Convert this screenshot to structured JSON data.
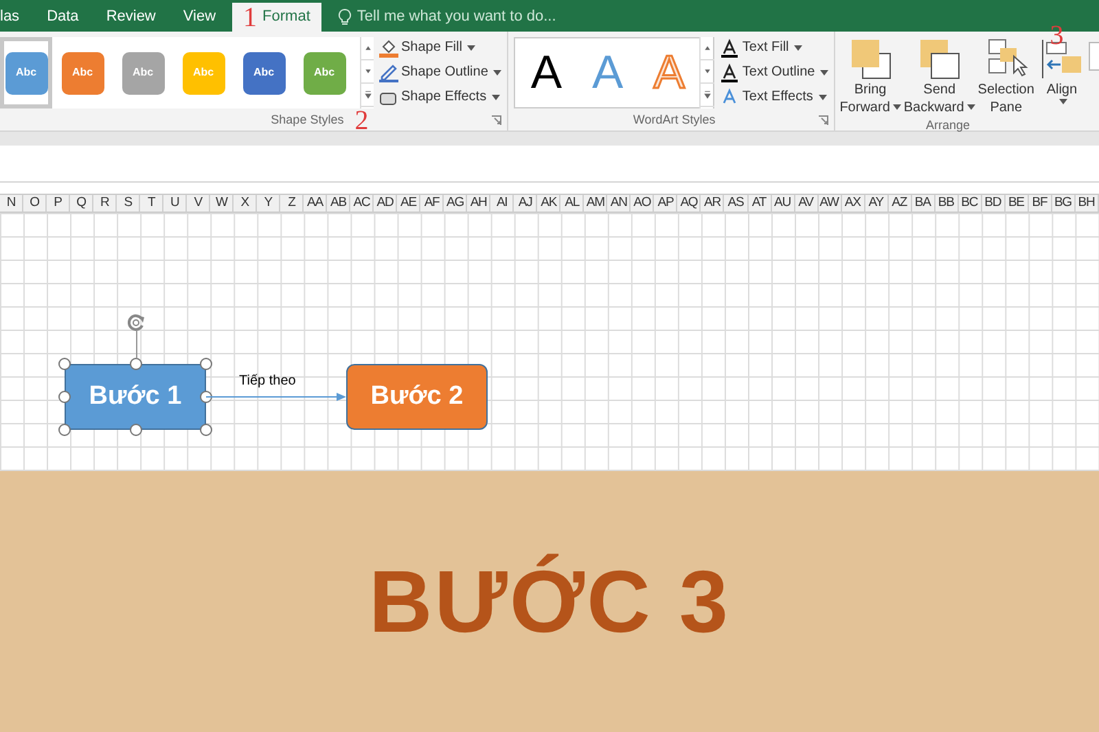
{
  "tabs": [
    {
      "label": "las",
      "selected": false
    },
    {
      "label": "Data",
      "selected": false
    },
    {
      "label": "Review",
      "selected": false
    },
    {
      "label": "View",
      "selected": false
    },
    {
      "label": "Format",
      "selected": true,
      "marker": "1"
    }
  ],
  "tell_me": {
    "placeholder": "Tell me what you want to do..."
  },
  "shape_styles": {
    "label": "Shape Styles",
    "marker": "2",
    "swatches": [
      {
        "label": "Abc",
        "color": "#5b9bd5",
        "selected": true
      },
      {
        "label": "Abc",
        "color": "#ed7d31",
        "selected": false
      },
      {
        "label": "Abc",
        "color": "#a5a5a5",
        "selected": false
      },
      {
        "label": "Abc",
        "color": "#ffc000",
        "selected": false
      },
      {
        "label": "Abc",
        "color": "#4472c4",
        "selected": false
      },
      {
        "label": "Abc",
        "color": "#70ad47",
        "selected": false
      }
    ],
    "commands": [
      {
        "label": "Shape Fill",
        "kind": "fill"
      },
      {
        "label": "Shape Outline",
        "kind": "outline"
      },
      {
        "label": "Shape Effects",
        "kind": "effects"
      }
    ]
  },
  "wordart_styles": {
    "label": "WordArt Styles",
    "samples": [
      {
        "label": "A",
        "kind": "black"
      },
      {
        "label": "A",
        "kind": "blue"
      },
      {
        "label": "A",
        "kind": "orange"
      }
    ],
    "commands": [
      {
        "label": "Text Fill",
        "kind": "fill"
      },
      {
        "label": "Text Outline",
        "kind": "outline"
      },
      {
        "label": "Text Effects",
        "kind": "effects"
      }
    ]
  },
  "arrange": {
    "label": "Arrange",
    "marker": "3",
    "commands": [
      {
        "line1": "Bring",
        "line2": "Forward",
        "kind": "forward"
      },
      {
        "line1": "Send",
        "line2": "Backward",
        "kind": "backward"
      },
      {
        "line1": "Selection",
        "line2": "Pane",
        "kind": "pane"
      },
      {
        "line1": "Align",
        "kind": "align"
      },
      {
        "kind": "group"
      }
    ]
  },
  "columns": [
    "N",
    "O",
    "P",
    "Q",
    "R",
    "S",
    "T",
    "U",
    "V",
    "W",
    "X",
    "Y",
    "Z",
    "AA",
    "AB",
    "AC",
    "AD",
    "AE",
    "AF",
    "AG",
    "AH",
    "AI",
    "AJ",
    "AK",
    "AL",
    "AM",
    "AN",
    "AO",
    "AP",
    "AQ",
    "AR",
    "AS",
    "AT",
    "AU",
    "AV",
    "AW",
    "AX",
    "AY",
    "AZ",
    "BA",
    "BB",
    "BC",
    "BD",
    "BE",
    "BF",
    "BG",
    "BH"
  ],
  "diagram": {
    "shapes": [
      {
        "label": "Bước 1",
        "color": "#5b9bd5",
        "selected": true
      },
      {
        "label": "Bước 2",
        "color": "#ed7d31",
        "selected": false
      }
    ],
    "connector": {
      "label": "Tiếp theo"
    }
  },
  "banner": {
    "title": "BƯỚC 3"
  }
}
